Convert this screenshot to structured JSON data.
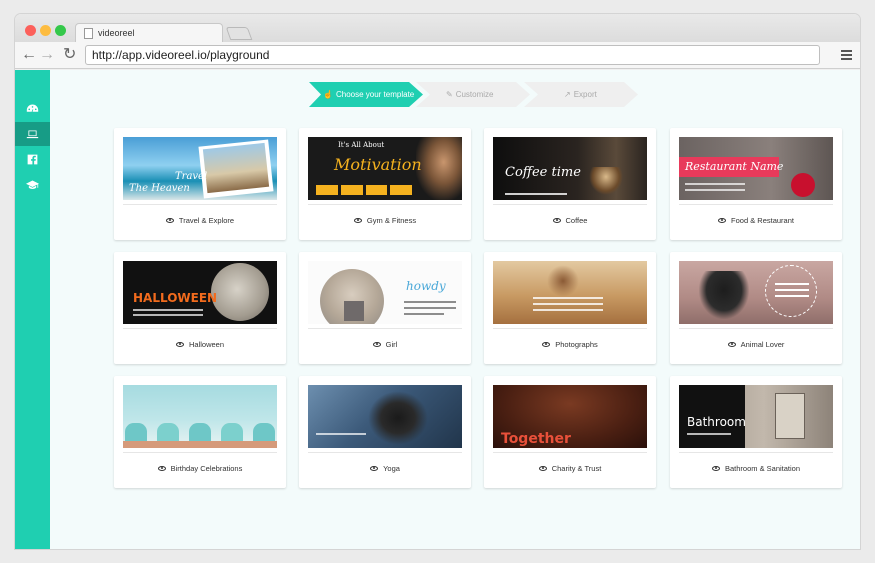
{
  "browser": {
    "tab_title": "videoreel",
    "url": "http://app.videoreel.io/playground"
  },
  "steps": [
    {
      "label": "Choose your template",
      "icon": "hand-pointer-icon",
      "active": true
    },
    {
      "label": "Customize",
      "icon": "edit-icon",
      "active": false
    },
    {
      "label": "Export",
      "icon": "share-icon",
      "active": false
    }
  ],
  "sidebar": [
    {
      "icon": "dashboard-icon"
    },
    {
      "icon": "laptop-icon",
      "active": true
    },
    {
      "icon": "facebook-icon"
    },
    {
      "icon": "graduation-cap-icon"
    }
  ],
  "templates": [
    {
      "label": "Travel & Explore",
      "thumb_text": "Travel\nThe Heaven"
    },
    {
      "label": "Gym & Fitness",
      "thumb_text": "It's All About\nMotivation"
    },
    {
      "label": "Coffee",
      "thumb_text": "Coffee time"
    },
    {
      "label": "Food & Restaurant",
      "thumb_text": "Restaurant Name"
    },
    {
      "label": "Halloween",
      "thumb_text": "HALLOWEEN"
    },
    {
      "label": "Girl",
      "thumb_text": "howdy"
    },
    {
      "label": "Photographs",
      "thumb_text": ""
    },
    {
      "label": "Animal Lover",
      "thumb_text": ""
    },
    {
      "label": "Birthday Celebrations",
      "thumb_text": ""
    },
    {
      "label": "Yoga",
      "thumb_text": ""
    },
    {
      "label": "Charity & Trust",
      "thumb_text": "Together"
    },
    {
      "label": "Bathroom & Sanitation",
      "thumb_text": "Bathroom"
    }
  ],
  "colors": {
    "accent": "#1fcfb1",
    "accent_dark": "#179c86",
    "background": "#f3fbfb"
  }
}
